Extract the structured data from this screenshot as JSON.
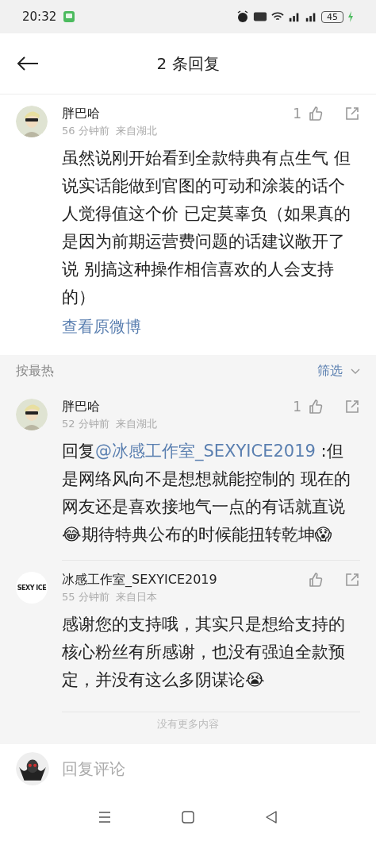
{
  "status_bar": {
    "time": "20:32",
    "battery": "45"
  },
  "header": {
    "title": "2 条回复"
  },
  "root_comment": {
    "author": "胖巴哈",
    "time": "56 分钟前",
    "location": "来自湖北",
    "likes": "1",
    "body": "虽然说刚开始看到全款特典有点生气 但说实话能做到官图的可动和涂装的话个人觉得值这个价 已定莫辜负（如果真的是因为前期运营费问题的话建议敞开了说 别搞这种操作相信喜欢的人会支持的）",
    "link": "查看原微博"
  },
  "sort_bar": {
    "label": "按最热",
    "filter": "筛选"
  },
  "replies": [
    {
      "author": "胖巴哈",
      "time": "52 分钟前",
      "location": "来自湖北",
      "likes": "1",
      "prefix": "回复",
      "mention": "@冰感工作室_SEXYICE2019",
      "body": " :但是网络风向不是想想就能控制的 现在的网友还是喜欢接地气一点的有话就直说😂期待特典公布的时候能扭转乾坤😱"
    },
    {
      "author": "冰感工作室_SEXYICE2019",
      "avatar": {
        "kind": "logo",
        "text": "SEXY ICE"
      },
      "time": "55 分钟前",
      "location": "来自日本",
      "body": "感谢您的支持哦，其实只是想给支持的核心粉丝有所感谢，也没有强迫全款预定，并没有这么多阴谋论😭"
    }
  ],
  "end_note": "没有更多内容",
  "reply_bar": {
    "placeholder": "回复评论"
  }
}
